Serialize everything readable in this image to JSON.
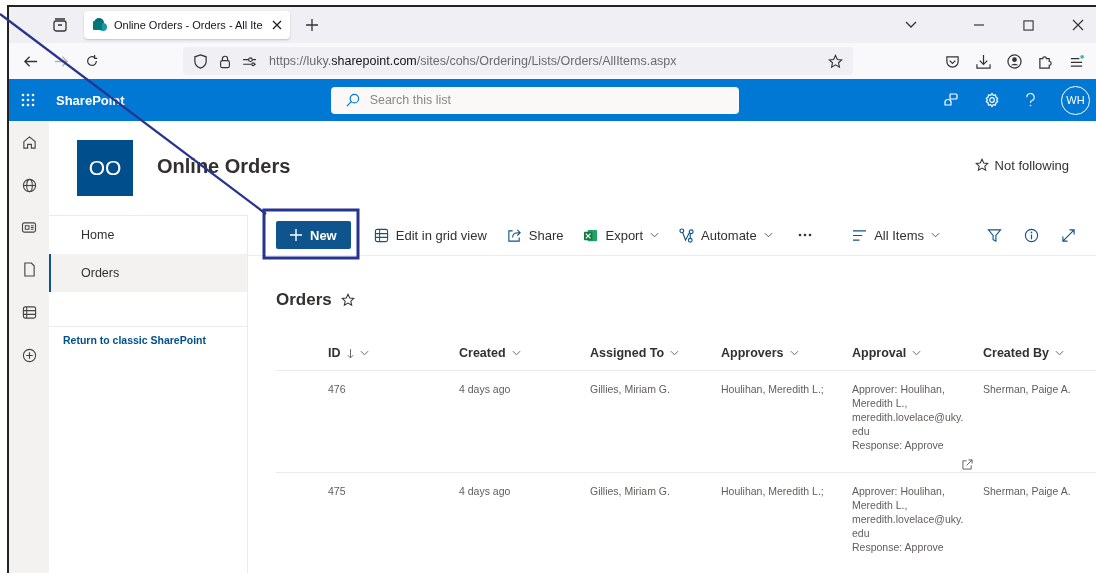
{
  "browser": {
    "tab_title": "Online Orders - Orders - All Ite",
    "url_prefix": "https://luky.",
    "url_domain": "sharepoint.com",
    "url_path": "/sites/cohs/Ordering/Lists/Orders/AllItems.aspx",
    "forward_disabled": true,
    "bookmarked": false
  },
  "app_bar": {
    "app_name": "SharePoint",
    "search": {
      "placeholder": "Search this list"
    },
    "avatar": "WH"
  },
  "site": {
    "logo": "OO",
    "title": "Online Orders",
    "follow": "Not following"
  },
  "nav": {
    "items": [
      {
        "label": "Home",
        "selected": false
      },
      {
        "label": "Orders",
        "selected": true
      }
    ],
    "classic_link": "Return to classic SharePoint"
  },
  "commands": {
    "new": "New",
    "items": [
      {
        "label": "Edit in grid view",
        "dropdown": false
      },
      {
        "label": "Share",
        "dropdown": false
      },
      {
        "label": "Export",
        "dropdown": true
      },
      {
        "label": "Automate",
        "dropdown": true
      }
    ],
    "view": "All Items"
  },
  "list": {
    "title": "Orders",
    "favorite": false,
    "columns": [
      {
        "label": "ID",
        "sorted_descending": true
      },
      {
        "label": "Created",
        "sorted_descending": false
      },
      {
        "label": "Assigned To",
        "sorted_descending": false
      },
      {
        "label": "Approvers",
        "sorted_descending": false
      },
      {
        "label": "Approval",
        "sorted_descending": false
      },
      {
        "label": "Created By",
        "sorted_descending": false
      }
    ],
    "rows": [
      {
        "id": "476",
        "created": "4 days ago",
        "assigned_to": "Gillies, Miriam G.",
        "approvers": "Houlihan, Meredith L.;",
        "approver": "Approver: Houlihan, Meredith L., meredith.lovelace@uky.edu",
        "response": "Response: Approve",
        "open_link": true,
        "created_by": "Sherman, Paige A."
      },
      {
        "id": "475",
        "created": "4 days ago",
        "assigned_to": "Gillies, Miriam G.",
        "approvers": "Houlihan, Meredith L.;",
        "approver": "Approver: Houlihan, Meredith L., meredith.lovelace@uky.edu",
        "response": "Response: Approve",
        "open_link": false,
        "created_by": "Sherman, Paige A."
      }
    ]
  }
}
